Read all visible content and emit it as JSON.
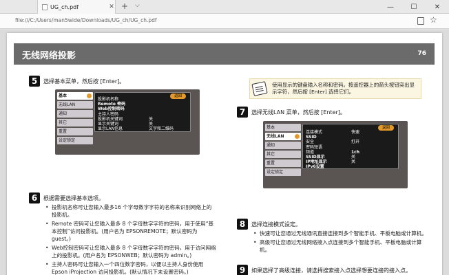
{
  "browser": {
    "tab_title": "UG_ch.pdf",
    "new_tab_glyph": "+",
    "tab_menu_glyph": "⌵",
    "address": "file:///C:/Users/man5wide/Downloads/UG_ch/UG_ch.pdf",
    "icons": [
      "pdf-file-icon",
      "close-icon",
      "plus-icon",
      "chevron-down-icon",
      "minimize-icon",
      "maximize-icon",
      "window-close-icon",
      "reading-view-icon",
      "star-icon"
    ]
  },
  "page": {
    "title": "无线网络投影",
    "number": "76"
  },
  "steps": {
    "s5": {
      "num": "5",
      "text": "选择基本菜单，然后按 [Enter]。"
    },
    "s6": {
      "num": "6",
      "text": "根据需要选择基本选项。",
      "bullets": [
        "投影机名称可让您输入最多16 个字母数字字符的名称来识别网络上的投影机。",
        "Remote 密码可让您输入最多 8 个字母数字字符的密码，用于使用“基本控制”访问投影机。(用户名为 EPSONREMOTE；默认密码为 guest。)",
        "Web控制密码可让您输入最多 8 个字母数字字符的密码，用于访问网络上的投影机。(用户名为 EPSONWEB；默认密码为 admin。)",
        "主持人密码可让您输入一个四位数字密码，以便以主持人身份使用 Epson iProjection 访问投影机。(默认情况下未设置密码。)"
      ]
    },
    "s7": {
      "num": "7",
      "text": "选择无线LAN 菜单，然后按 [Enter]。"
    },
    "s8": {
      "num": "8",
      "text": "选择连接模式设定。",
      "bullets": [
        "快速可让您通过无线通讯直接连接到多个智能手机、平板电脑或计算机。",
        "高级可让您通过无线网络接入点连接到多个智能手机、平板电脑或计算机。"
      ]
    },
    "s9": {
      "num": "9",
      "text": "如果选择了高级连接，请选择搜索接入点选择想要连接的接入点。"
    }
  },
  "note": {
    "text": "使用显示的键盘输入名称和密码。按遥控器上的箭头按钮突出显示字符，然后按 [Enter] 选择它们。"
  },
  "menu1": {
    "side": [
      "基本",
      "无线LAN",
      "通知",
      "其它",
      "重置",
      "设定锁定"
    ],
    "active_index": 0,
    "return": "返回",
    "rows": [
      {
        "label": "投影机名称",
        "value": ""
      },
      {
        "label": "Remote 密码",
        "value": ""
      },
      {
        "label": "Web控制密码",
        "value": ""
      },
      {
        "label": "主持人密码",
        "value": ""
      },
      {
        "label": "投影机关键词",
        "value": "关"
      },
      {
        "label": "显示关键词",
        "value": "关"
      },
      {
        "label": "显示LAN信息",
        "value": "文字和二维码"
      }
    ]
  },
  "menu2": {
    "side": [
      "基本",
      "无线LAN",
      "通知",
      "其它",
      "重置",
      "设定锁定"
    ],
    "active_index": 1,
    "return": "返回",
    "rows": [
      {
        "label": "连接模式",
        "value": "快速"
      },
      {
        "label": "SSID",
        "value": ""
      },
      {
        "label": "安全",
        "value": "打开"
      },
      {
        "label": "密码短语",
        "value": ""
      },
      {
        "label": "频道",
        "value": "1ch"
      },
      {
        "label": "SSID显示",
        "value": "关"
      },
      {
        "label": "IP地址显示",
        "value": "关"
      },
      {
        "label": "IPv6设置",
        "value": ""
      }
    ]
  }
}
